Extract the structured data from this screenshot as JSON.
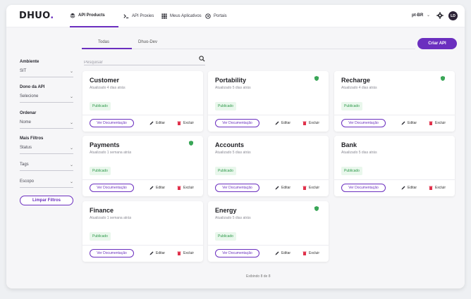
{
  "brand": {
    "logo": "DHUO",
    "logo_dot": "."
  },
  "topnav": {
    "items": [
      {
        "label": "API Products",
        "icon": "layers-icon",
        "active": true
      },
      {
        "label": "API Proxies",
        "icon": "terminal-icon",
        "active": false
      },
      {
        "label": "Meus Aplicativos",
        "icon": "grid-icon",
        "active": false
      },
      {
        "label": "Portais",
        "icon": "globe-icon",
        "active": false
      }
    ],
    "language": "pt-BR",
    "avatar_initials": "LD"
  },
  "tabs": [
    {
      "label": "Todas",
      "active": true
    },
    {
      "label": "Dhuo-Dev",
      "active": false
    }
  ],
  "create_button": "Criar API",
  "search": {
    "placeholder": "Pesquisar",
    "value": ""
  },
  "sidebar": {
    "ambiente_label": "Ambiente",
    "ambiente_value": "SIT",
    "dono_label": "Dono da API",
    "dono_value": "Selecione",
    "ordenar_label": "Ordenar",
    "ordenar_value": "Nome",
    "mais_filtros_label": "Mais Filtros",
    "status_value": "Status",
    "tags_value": "Tags",
    "escopo_value": "Escopo",
    "clear_button": "Limpar Filtros"
  },
  "card_actions": {
    "doc_label": "Ver Documentação",
    "edit_label": "Editar",
    "delete_label": "Excluir"
  },
  "cards": [
    {
      "title": "Customer",
      "updated": "Atualizado 4 dias atrás",
      "status": "Publicado",
      "shield": false
    },
    {
      "title": "Portability",
      "updated": "Atualizado 5 dias atrás",
      "status": "Publicado",
      "shield": true
    },
    {
      "title": "Recharge",
      "updated": "Atualizado 4 dias atrás",
      "status": "Publicado",
      "shield": true
    },
    {
      "title": "Payments",
      "updated": "Atualizado 1 semana atrás",
      "status": "Publicado",
      "shield": true
    },
    {
      "title": "Accounts",
      "updated": "Atualizado 5 dias atrás",
      "status": "Publicado",
      "shield": false
    },
    {
      "title": "Bank",
      "updated": "Atualizado 5 dias atrás",
      "status": "Publicado",
      "shield": false
    },
    {
      "title": "Finance",
      "updated": "Atualizado 1 semana atrás",
      "status": "Publicado",
      "shield": false
    },
    {
      "title": "Energy",
      "updated": "Atualizado 5 dias atrás",
      "status": "Publicado",
      "shield": true
    }
  ],
  "footer": {
    "count_text": "Exibindo 8 de 8"
  },
  "colors": {
    "accent": "#6b2fbf",
    "published_bg": "#e9f7ec",
    "published_text": "#2e9a4a",
    "shield": "#3aa657"
  }
}
